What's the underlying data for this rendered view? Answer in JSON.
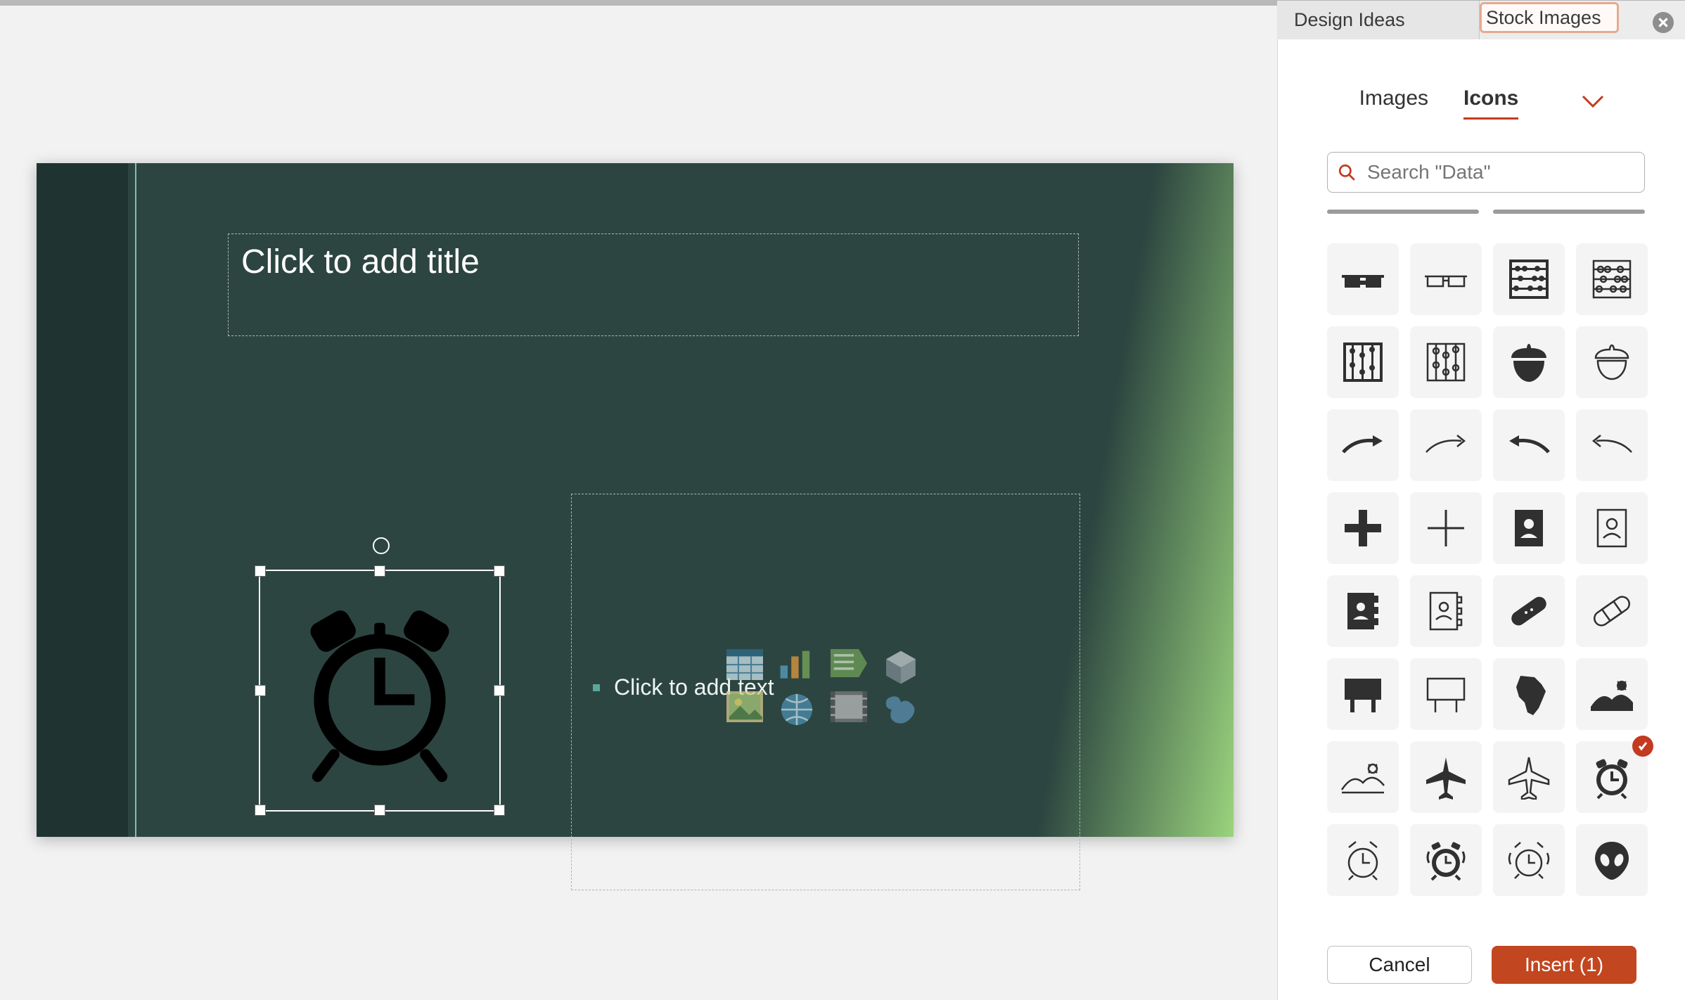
{
  "panes": {
    "design_ideas_label": "Design Ideas",
    "stock_images_label": "Stock Images"
  },
  "stock_pane": {
    "tabs": {
      "images": "Images",
      "icons": "Icons"
    },
    "search_placeholder": "Search \"Data\"",
    "icons": [
      {
        "name": "3d-glasses-solid"
      },
      {
        "name": "3d-glasses-outline"
      },
      {
        "name": "abacus-solid"
      },
      {
        "name": "abacus-outline"
      },
      {
        "name": "abacus-vertical-solid"
      },
      {
        "name": "abacus-vertical-outline"
      },
      {
        "name": "acorn-solid"
      },
      {
        "name": "acorn-outline"
      },
      {
        "name": "arrow-curve-right-solid"
      },
      {
        "name": "arrow-curve-right-thin"
      },
      {
        "name": "arrow-curve-left-solid"
      },
      {
        "name": "arrow-curve-left-thin"
      },
      {
        "name": "plus-bold"
      },
      {
        "name": "plus-thin"
      },
      {
        "name": "address-book-solid"
      },
      {
        "name": "address-book-outline"
      },
      {
        "name": "address-book-tab-solid"
      },
      {
        "name": "address-book-tab-outline"
      },
      {
        "name": "bandage-solid"
      },
      {
        "name": "bandage-outline"
      },
      {
        "name": "billboard-solid"
      },
      {
        "name": "billboard-outline"
      },
      {
        "name": "africa-solid"
      },
      {
        "name": "agriculture-scene-solid"
      },
      {
        "name": "agriculture-scene-outline"
      },
      {
        "name": "airplane-solid"
      },
      {
        "name": "airplane-outline"
      },
      {
        "name": "alarm-clock-solid",
        "selected": true
      },
      {
        "name": "alarm-clock-outline-1"
      },
      {
        "name": "alarm-clock-ringing-solid"
      },
      {
        "name": "alarm-clock-ringing-outline"
      },
      {
        "name": "alien-solid"
      }
    ],
    "cancel_label": "Cancel",
    "insert_label": "Insert (1)",
    "selected_count": 1
  },
  "slide": {
    "title_placeholder": "Click to add title",
    "content_placeholder": "Click to add text",
    "inserted_icon": "alarm-clock-solid"
  }
}
